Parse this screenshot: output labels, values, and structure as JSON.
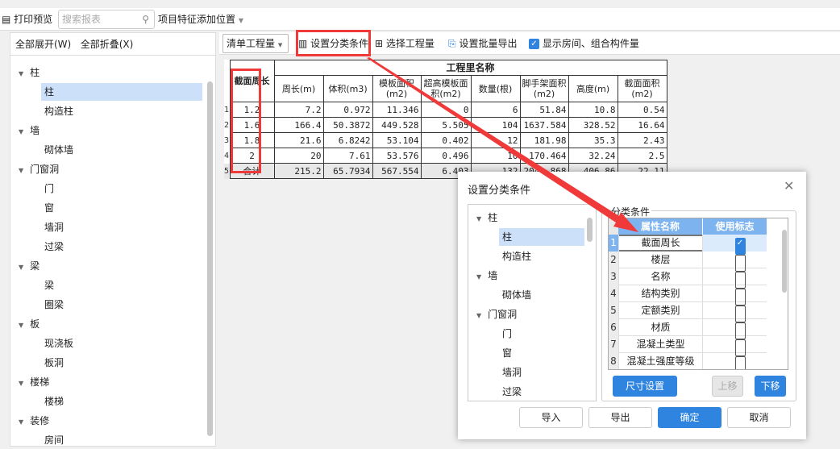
{
  "toolbar": {
    "print_preview": "打印预览",
    "search_placeholder": "搜索报表",
    "feature_position": "项目特征添加位置"
  },
  "left_panel": {
    "expand_all": "全部展开(W)",
    "collapse_all": "全部折叠(X)",
    "tree": [
      {
        "label": "柱",
        "children": [
          "柱",
          "构造柱"
        ]
      },
      {
        "label": "墙",
        "children": [
          "砌体墙"
        ]
      },
      {
        "label": "门窗洞",
        "children": [
          "门",
          "窗",
          "墙洞",
          "过梁"
        ]
      },
      {
        "label": "梁",
        "children": [
          "梁",
          "圈梁"
        ]
      },
      {
        "label": "板",
        "children": [
          "现浇板",
          "板洞"
        ]
      },
      {
        "label": "楼梯",
        "children": [
          "楼梯"
        ]
      },
      {
        "label": "装修",
        "children": [
          "房间"
        ]
      }
    ]
  },
  "right_toolbar": {
    "quantity_select": "清单工程量",
    "set_classification": "设置分类条件",
    "select_quantity": "选择工程量",
    "batch_export": "设置批量导出",
    "show_rooms": "显示房间、组合构件量"
  },
  "table": {
    "group_header": "工程里名称",
    "first_col": "截面周长",
    "columns": [
      "周长(m)",
      "体积(m3)",
      "模板面积(m2)",
      "超高模板面积(m2)",
      "数量(根)",
      "脚手架面积(m2)",
      "高度(m)",
      "截面面积(m2)"
    ],
    "rows": [
      {
        "n": "1",
        "key": "1.2",
        "vals": [
          "7.2",
          "0.972",
          "11.346",
          "0",
          "6",
          "51.84",
          "10.8",
          "0.54"
        ]
      },
      {
        "n": "2",
        "key": "1.6",
        "vals": [
          "166.4",
          "50.3872",
          "449.528",
          "5.505",
          "104",
          "1637.584",
          "328.52",
          "16.64"
        ]
      },
      {
        "n": "3",
        "key": "1.8",
        "vals": [
          "21.6",
          "6.8242",
          "53.104",
          "0.402",
          "12",
          "181.98",
          "35.3",
          "2.43"
        ]
      },
      {
        "n": "4",
        "key": "2",
        "vals": [
          "20",
          "7.61",
          "53.576",
          "0.496",
          "10",
          "170.464",
          "32.24",
          "2.5"
        ]
      },
      {
        "n": "5",
        "key": "合计",
        "vals": [
          "215.2",
          "65.7934",
          "567.554",
          "6.403",
          "132",
          "2041.868",
          "406.86",
          "22.11"
        ]
      }
    ]
  },
  "dialog": {
    "title": "设置分类条件",
    "group_label": "分类条件",
    "col_name": "属性名称",
    "col_flag": "使用标志",
    "tree": [
      {
        "label": "柱",
        "children": [
          "柱",
          "构造柱"
        ]
      },
      {
        "label": "墙",
        "children": [
          "砌体墙"
        ]
      },
      {
        "label": "门窗洞",
        "children": [
          "门",
          "窗",
          "墙洞",
          "过梁"
        ]
      }
    ],
    "rows": [
      {
        "n": "1",
        "name": "截面周长",
        "checked": true
      },
      {
        "n": "2",
        "name": "楼层",
        "checked": false
      },
      {
        "n": "3",
        "name": "名称",
        "checked": false
      },
      {
        "n": "4",
        "name": "结构类别",
        "checked": false
      },
      {
        "n": "5",
        "name": "定额类别",
        "checked": false
      },
      {
        "n": "6",
        "name": "材质",
        "checked": false
      },
      {
        "n": "7",
        "name": "混凝土类型",
        "checked": false
      },
      {
        "n": "8",
        "name": "混凝土强度等级",
        "checked": false
      }
    ],
    "size_settings": "尺寸设置",
    "move_up": "上移",
    "move_down": "下移",
    "import": "导入",
    "export": "导出",
    "ok": "确定",
    "cancel": "取消"
  },
  "colors": {
    "accent": "#2f84e0",
    "annotation": "#f03a3a"
  }
}
